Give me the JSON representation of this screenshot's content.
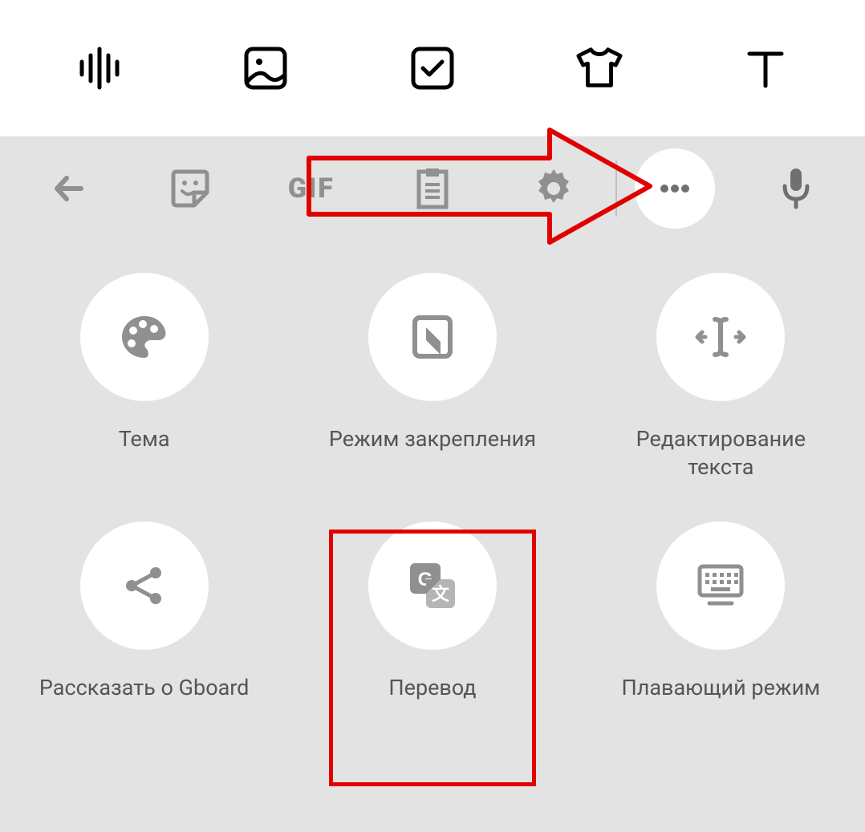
{
  "top_icons": {
    "sound": "sound-wave-icon",
    "image": "image-icon",
    "checkbox": "checkbox-icon",
    "shirt": "tshirt-icon",
    "text": "text-tool-icon"
  },
  "toolbar": {
    "back": "back-icon",
    "sticker": "sticker-icon",
    "gif_label": "GIF",
    "clipboard": "clipboard-icon",
    "settings": "settings-icon",
    "more": "more-icon",
    "mic": "microphone-icon"
  },
  "grid": {
    "theme_label": "Тема",
    "pin_label": "Режим закрепления",
    "text_edit_label": "Редактирование текста",
    "share_label": "Рассказать о Gboard",
    "translate_label": "Перевод",
    "floating_label": "Плавающий режим"
  }
}
